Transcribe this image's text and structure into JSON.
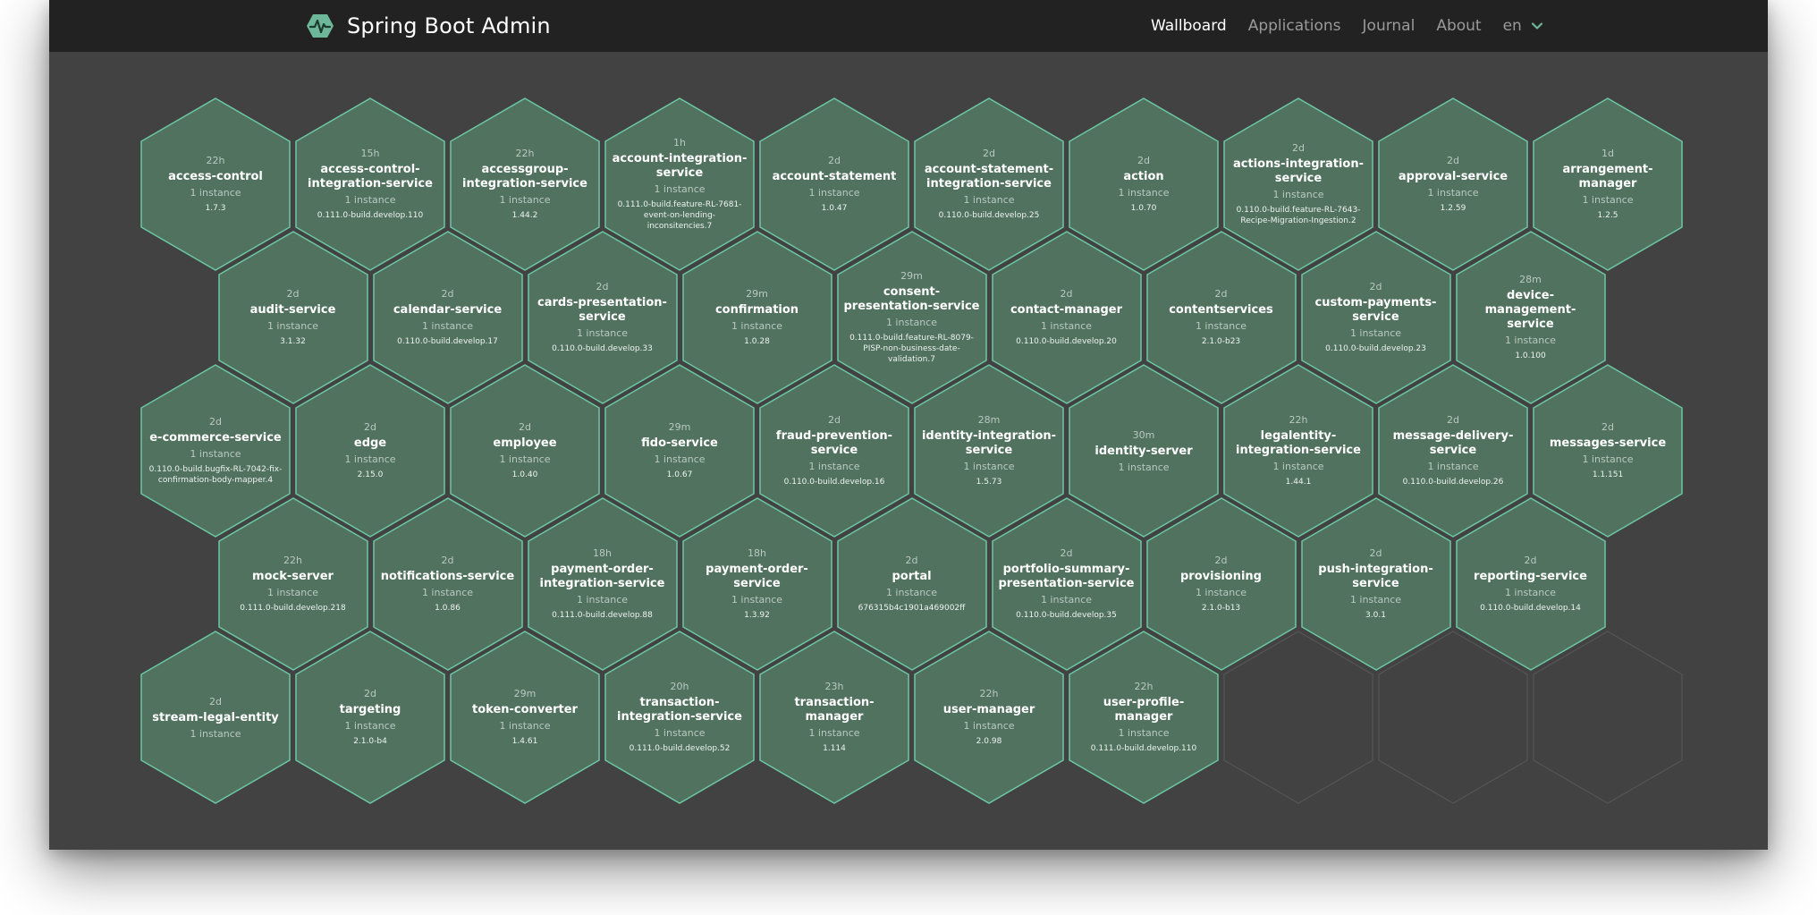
{
  "brand": {
    "title": "Spring Boot Admin",
    "logo_icon": "heartbeat-hexagon-icon",
    "accent": "#6db89a"
  },
  "nav": {
    "links": [
      "Wallboard",
      "Applications",
      "Journal",
      "About"
    ],
    "active": "Wallboard",
    "language": "en"
  },
  "colors": {
    "page_bg": "#424242",
    "navbar_bg": "#222222",
    "hex_fill": "#51725f",
    "hex_stroke": "#6cc8a4",
    "hex_empty_stroke": "#555555"
  },
  "applications": [
    {
      "name": "access-control",
      "time": "22h",
      "instances": "1 instance",
      "version": "1.7.3"
    },
    {
      "name": "access-control-integration-service",
      "time": "15h",
      "instances": "1 instance",
      "version": "0.111.0-build.develop.110"
    },
    {
      "name": "accessgroup-integration-service",
      "time": "22h",
      "instances": "1 instance",
      "version": "1.44.2"
    },
    {
      "name": "account-integration-service",
      "time": "1h",
      "instances": "1 instance",
      "version": "0.111.0-build.feature-RL-7681-event-on-lending-inconsitencies.7"
    },
    {
      "name": "account-statement",
      "time": "2d",
      "instances": "1 instance",
      "version": "1.0.47"
    },
    {
      "name": "account-statement-integration-service",
      "time": "2d",
      "instances": "1 instance",
      "version": "0.110.0-build.develop.25"
    },
    {
      "name": "action",
      "time": "2d",
      "instances": "1 instance",
      "version": "1.0.70"
    },
    {
      "name": "actions-integration-service",
      "time": "2d",
      "instances": "1 instance",
      "version": "0.110.0-build.feature-RL-7643-Recipe-Migration-Ingestion.2"
    },
    {
      "name": "approval-service",
      "time": "2d",
      "instances": "1 instance",
      "version": "1.2.59"
    },
    {
      "name": "arrangement-manager",
      "time": "1d",
      "instances": "1 instance",
      "version": "1.2.5"
    },
    {
      "name": "audit-service",
      "time": "2d",
      "instances": "1 instance",
      "version": "3.1.32"
    },
    {
      "name": "calendar-service",
      "time": "2d",
      "instances": "1 instance",
      "version": "0.110.0-build.develop.17"
    },
    {
      "name": "cards-presentation-service",
      "time": "2d",
      "instances": "1 instance",
      "version": "0.110.0-build.develop.33"
    },
    {
      "name": "confirmation",
      "time": "29m",
      "instances": "1 instance",
      "version": "1.0.28"
    },
    {
      "name": "consent-presentation-service",
      "time": "29m",
      "instances": "1 instance",
      "version": "0.111.0-build.feature-RL-8079-PISP-non-business-date-validation.7"
    },
    {
      "name": "contact-manager",
      "time": "2d",
      "instances": "1 instance",
      "version": "0.110.0-build.develop.20"
    },
    {
      "name": "contentservices",
      "time": "2d",
      "instances": "1 instance",
      "version": "2.1.0-b23"
    },
    {
      "name": "custom-payments-service",
      "time": "2d",
      "instances": "1 instance",
      "version": "0.110.0-build.develop.23"
    },
    {
      "name": "device-management-service",
      "time": "28m",
      "instances": "1 instance",
      "version": "1.0.100"
    },
    {
      "name": "e-commerce-service",
      "time": "2d",
      "instances": "1 instance",
      "version": "0.110.0-build.bugfix-RL-7042-fix-confirmation-body-mapper.4"
    },
    {
      "name": "edge",
      "time": "2d",
      "instances": "1 instance",
      "version": "2.15.0"
    },
    {
      "name": "employee",
      "time": "2d",
      "instances": "1 instance",
      "version": "1.0.40"
    },
    {
      "name": "fido-service",
      "time": "29m",
      "instances": "1 instance",
      "version": "1.0.67"
    },
    {
      "name": "fraud-prevention-service",
      "time": "2d",
      "instances": "1 instance",
      "version": "0.110.0-build.develop.16"
    },
    {
      "name": "identity-integration-service",
      "time": "28m",
      "instances": "1 instance",
      "version": "1.5.73"
    },
    {
      "name": "identity-server",
      "time": "30m",
      "instances": "1 instance",
      "version": ""
    },
    {
      "name": "legalentity-integration-service",
      "time": "22h",
      "instances": "1 instance",
      "version": "1.44.1"
    },
    {
      "name": "message-delivery-service",
      "time": "2d",
      "instances": "1 instance",
      "version": "0.110.0-build.develop.26"
    },
    {
      "name": "messages-service",
      "time": "2d",
      "instances": "1 instance",
      "version": "1.1.151"
    },
    {
      "name": "mock-server",
      "time": "22h",
      "instances": "1 instance",
      "version": "0.111.0-build.develop.218"
    },
    {
      "name": "notifications-service",
      "time": "2d",
      "instances": "1 instance",
      "version": "1.0.86"
    },
    {
      "name": "payment-order-integration-service",
      "time": "18h",
      "instances": "1 instance",
      "version": "0.111.0-build.develop.88"
    },
    {
      "name": "payment-order-service",
      "time": "18h",
      "instances": "1 instance",
      "version": "1.3.92"
    },
    {
      "name": "portal",
      "time": "2d",
      "instances": "1 instance",
      "version": "676315b4c1901a469002ff"
    },
    {
      "name": "portfolio-summary-presentation-service",
      "time": "2d",
      "instances": "1 instance",
      "version": "0.110.0-build.develop.35"
    },
    {
      "name": "provisioning",
      "time": "2d",
      "instances": "1 instance",
      "version": "2.1.0-b13"
    },
    {
      "name": "push-integration-service",
      "time": "2d",
      "instances": "1 instance",
      "version": "3.0.1"
    },
    {
      "name": "reporting-service",
      "time": "2d",
      "instances": "1 instance",
      "version": "0.110.0-build.develop.14"
    },
    {
      "name": "stream-legal-entity",
      "time": "2d",
      "instances": "1 instance",
      "version": ""
    },
    {
      "name": "targeting",
      "time": "2d",
      "instances": "1 instance",
      "version": "2.1.0-b4"
    },
    {
      "name": "token-converter",
      "time": "29m",
      "instances": "1 instance",
      "version": "1.4.61"
    },
    {
      "name": "transaction-integration-service",
      "time": "20h",
      "instances": "1 instance",
      "version": "0.111.0-build.develop.52"
    },
    {
      "name": "transaction-manager",
      "time": "23h",
      "instances": "1 instance",
      "version": "1.114"
    },
    {
      "name": "user-manager",
      "time": "22h",
      "instances": "1 instance",
      "version": "2.0.98"
    },
    {
      "name": "user-profile-manager",
      "time": "22h",
      "instances": "1 instance",
      "version": "0.111.0-build.develop.110"
    }
  ]
}
